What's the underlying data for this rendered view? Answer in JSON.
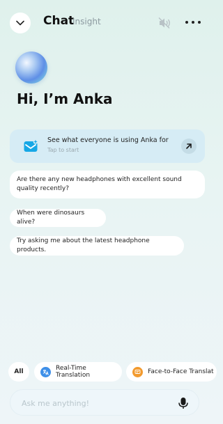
{
  "header": {
    "title": "Chat",
    "subtitle": "Insight",
    "back_icon": "chevron-down-icon",
    "mute_icon": "speaker-muted-icon",
    "more_icon": "more-icon"
  },
  "assistant": {
    "greeting": "Hi, I’m Anka"
  },
  "feature_card": {
    "title": "See what everyone is using Anka for",
    "subtitle": "Tap to start",
    "icon": "mail-star-icon",
    "action_icon": "arrow-up-right-icon"
  },
  "suggestions": [
    "Are there any new headphones with excellent sound quality recently?",
    "When were dinosaurs alive?",
    "Try asking me about the latest headphone products."
  ],
  "chips": [
    {
      "label": "All"
    },
    {
      "label": "Real-Time Translation",
      "icon": "translate-icon",
      "color": "#3e8fe8"
    },
    {
      "label": "Face-to-Face Translat",
      "icon": "chat-icon",
      "color": "#f29a2e"
    }
  ],
  "input": {
    "placeholder": "Ask me anything!",
    "mic_icon": "microphone-icon"
  },
  "colors": {
    "background": "#dff1ec",
    "card": "#d6ecf5",
    "accent": "#1aa7e8"
  }
}
